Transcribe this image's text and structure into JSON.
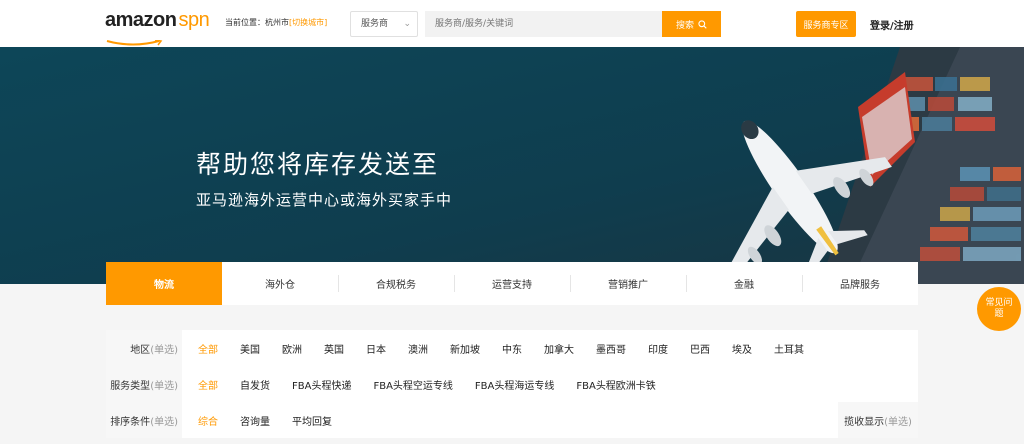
{
  "header": {
    "logo": {
      "main": "amazon",
      "accent": "spn"
    },
    "location_label": "当前位置：",
    "location_city": "杭州市",
    "location_switch": "[切换城市]",
    "category_select": "服务商",
    "search_placeholder": "服务商/服务/关键词",
    "search_button": "搜索",
    "provider_zone_button": "服务商专区",
    "login": "登录/注册"
  },
  "banner": {
    "title": "帮助您将库存发送至",
    "subtitle": "亚马逊海外运营中心或海外买家手中"
  },
  "tabs": [
    {
      "label": "物流",
      "active": true
    },
    {
      "label": "海外仓",
      "active": false
    },
    {
      "label": "合规税务",
      "active": false
    },
    {
      "label": "运营支持",
      "active": false
    },
    {
      "label": "营销推广",
      "active": false
    },
    {
      "label": "金融",
      "active": false
    },
    {
      "label": "品牌服务",
      "active": false
    }
  ],
  "filters": {
    "region": {
      "label": "地区",
      "hint": "(单选)",
      "options": [
        "全部",
        "美国",
        "欧洲",
        "英国",
        "日本",
        "澳洲",
        "新加坡",
        "中东",
        "加拿大",
        "墨西哥",
        "印度",
        "巴西",
        "埃及",
        "土耳其"
      ]
    },
    "service_type": {
      "label": "服务类型",
      "hint": "(单选)",
      "options": [
        "全部",
        "自发货",
        "FBA头程快递",
        "FBA头程空运专线",
        "FBA头程海运专线",
        "FBA头程欧洲卡铁"
      ]
    },
    "sort": {
      "label": "排序条件",
      "hint": "(单选)",
      "options": [
        "综合",
        "咨询量",
        "平均回复"
      ],
      "right_label": "揽收显示",
      "right_hint": "(单选)"
    }
  },
  "faq_button": "常见问题",
  "colors": {
    "accent": "#ff9900",
    "banner_bg": "#0e4a5c"
  }
}
